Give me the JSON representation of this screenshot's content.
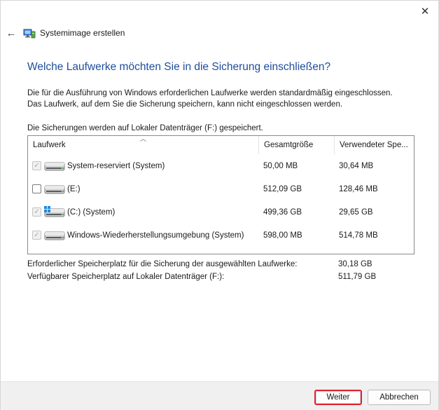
{
  "window": {
    "title": "Systemimage erstellen",
    "close_glyph": "✕",
    "back_glyph": "←"
  },
  "heading": "Welche Laufwerke möchten Sie in die Sicherung einschließen?",
  "description": {
    "line1": "Die für die Ausführung von Windows erforderlichen Laufwerke werden standardmäßig eingeschlossen.",
    "line2": "Das Laufwerk, auf dem Sie die Sicherung speichern, kann nicht eingeschlossen werden."
  },
  "save_note": "Die Sicherungen werden auf Lokaler Datenträger (F:) gespeichert.",
  "table": {
    "columns": [
      "Laufwerk",
      "Gesamtgröße",
      "Verwendeter Spe..."
    ],
    "rows": [
      {
        "name": "System-reserviert (System)",
        "size": "50,00 MB",
        "used": "30,64 MB",
        "checked": true,
        "disabled": true,
        "windows_logo": false
      },
      {
        "name": "(E:)",
        "size": "512,09 GB",
        "used": "128,46 MB",
        "checked": false,
        "disabled": false,
        "windows_logo": false
      },
      {
        "name": "(C:) (System)",
        "size": "499,36 GB",
        "used": "29,65 GB",
        "checked": true,
        "disabled": true,
        "windows_logo": true
      },
      {
        "name": "Windows-Wiederherstellungsumgebung (System)",
        "size": "598,00 MB",
        "used": "514,78 MB",
        "checked": true,
        "disabled": true,
        "windows_logo": false
      }
    ]
  },
  "summary": {
    "required_label": "Erforderlicher Speicherplatz für die Sicherung der ausgewählten Laufwerke:",
    "required_value": "30,18 GB",
    "available_label": "Verfügbarer Speicherplatz auf Lokaler Datenträger (F:):",
    "available_value": "511,79 GB"
  },
  "buttons": {
    "next": "Weiter",
    "cancel": "Abbrechen"
  },
  "colors": {
    "heading": "#1f4e9c",
    "highlight": "#e0242d",
    "footer_bg": "#f0f0f0"
  }
}
